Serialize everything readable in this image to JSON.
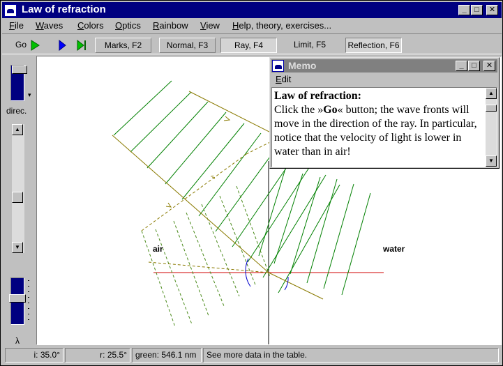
{
  "window": {
    "title": "Law of refraction"
  },
  "menu": [
    {
      "label": "File",
      "u": "F",
      "rest": "ile"
    },
    {
      "label": "Waves",
      "u": "W",
      "rest": "aves"
    },
    {
      "label": "Colors",
      "u": "C",
      "rest": "olors"
    },
    {
      "label": "Optics",
      "u": "O",
      "rest": "ptics"
    },
    {
      "label": "Rainbow",
      "u": "R",
      "rest": "ainbow"
    },
    {
      "label": "View",
      "u": "V",
      "rest": "iew"
    },
    {
      "label": "Help, theory, exercises...",
      "u": "H",
      "rest": "elp, theory, exercises..."
    }
  ],
  "toolbar": {
    "go_label": "Go",
    "marks": "Marks, F2",
    "normal": "Normal, F3",
    "ray": "Ray, F4",
    "limit": "Limit, F5",
    "reflection": "Reflection, F6"
  },
  "left": {
    "direc_label": "direc.",
    "lambda_label": "λ"
  },
  "canvas": {
    "air_label": "air",
    "water_label": "water"
  },
  "memo": {
    "title": "Memo",
    "menu_edit_u": "E",
    "menu_edit_rest": "dit",
    "heading": "Law of refraction:",
    "text_before": "Click the »",
    "text_go": "Go",
    "text_after": "« button; the wave fronts will move in the direction of the ray. In particular, notice that the velocity of light is lower in water than in air!"
  },
  "status": {
    "incidence": "i: 35.0°",
    "refraction": "r: 25.5°",
    "wavelength": "green: 546.1 nm",
    "hint": "See more data in the table."
  },
  "colors": {
    "wave": "#008000",
    "wave_reflected": "#4a8a1a",
    "ray": "#8a7a00",
    "surface": "#d00000",
    "angle": "#0000cc"
  }
}
